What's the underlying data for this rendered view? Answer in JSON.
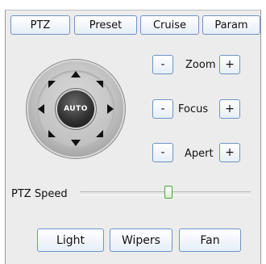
{
  "tabs": [
    {
      "label": "PTZ"
    },
    {
      "label": "Preset"
    },
    {
      "label": "Cruise"
    },
    {
      "label": "Param"
    }
  ],
  "joystick": {
    "center_label": "AUTO"
  },
  "controls": {
    "zoom": {
      "label": "Zoom",
      "minus": "-",
      "plus": "+"
    },
    "focus": {
      "label": "Focus",
      "minus": "-",
      "plus": "+"
    },
    "apert": {
      "label": "Apert",
      "minus": "-",
      "plus": "+"
    }
  },
  "speed": {
    "label": "PTZ Speed",
    "value_fraction": 0.52
  },
  "bottom_buttons": [
    {
      "label": "Light"
    },
    {
      "label": "Wipers"
    },
    {
      "label": "Fan"
    }
  ]
}
